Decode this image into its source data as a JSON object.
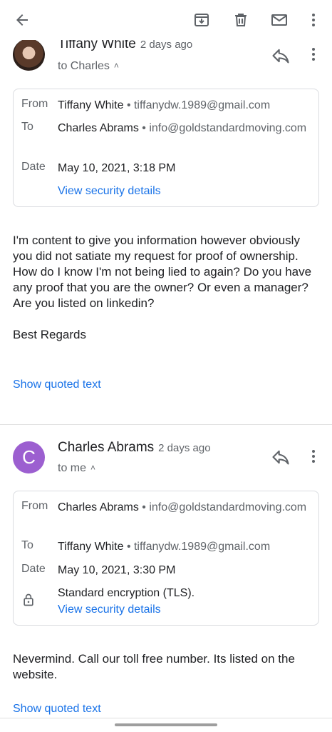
{
  "toolbar": {
    "back_icon": "arrow-back-icon",
    "archive_icon": "archive-icon",
    "delete_icon": "trash-icon",
    "mail_icon": "mark-unread-icon",
    "more_icon": "more-vert-icon"
  },
  "messages": [
    {
      "sender": "Tiffany White",
      "time": "2 days ago",
      "to_line": "to Charles",
      "details": {
        "from_label": "From",
        "from_name": "Tiffany White",
        "from_email": "tiffanydw.1989@gmail.com",
        "to_label": "To",
        "to_name": "Charles Abrams",
        "to_email": "info@goldstandardmoving.com",
        "date_label": "Date",
        "date": "May 10, 2021, 3:18 PM",
        "security_link": "View security details"
      },
      "body": [
        "I'm content to give you information however obviously you did not satiate my request for proof of ownership. How do I know I'm not being lied to again? Do you have any proof that you are the owner? Or even a manager? Are you listed on linkedin?",
        "Best Regards"
      ],
      "show_quoted": "Show quoted text"
    },
    {
      "sender": "Charles Abrams",
      "avatar_letter": "C",
      "time": "2 days ago",
      "to_line": "to me",
      "details": {
        "from_label": "From",
        "from_name": "Charles Abrams",
        "from_email": "info@goldstandardmoving.com",
        "to_label": "To",
        "to_name": "Tiffany White",
        "to_email": "tiffanydw.1989@gmail.com",
        "date_label": "Date",
        "date": "May 10, 2021, 3:30 PM",
        "encryption": "Standard encryption (TLS).",
        "security_link": "View security details"
      },
      "body": [
        "Nevermind. Call our toll free number. Its listed on the website."
      ],
      "show_quoted": "Show quoted text"
    }
  ],
  "colors": {
    "accent": "#1a73e8",
    "avatar_c": "#9c5fd0",
    "text": "#202124",
    "muted": "#5f6368"
  }
}
